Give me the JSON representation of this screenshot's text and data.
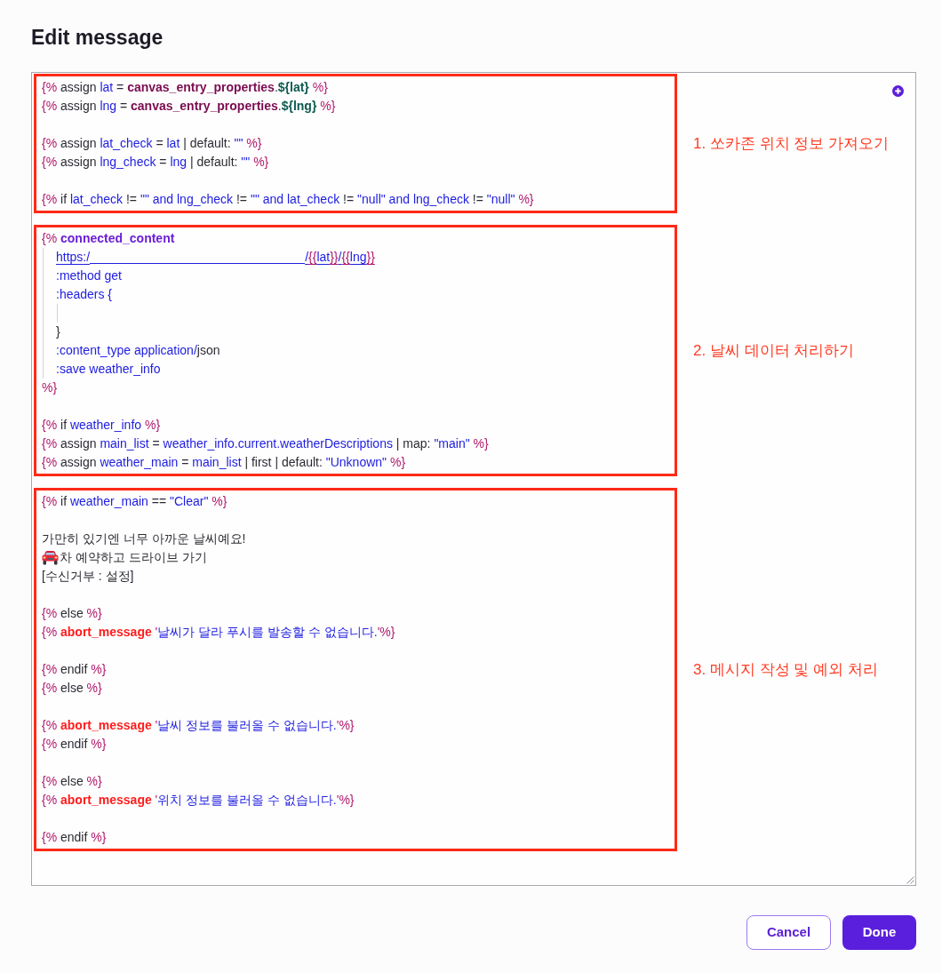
{
  "dialog": {
    "title": "Edit message"
  },
  "editor": {
    "sections": [
      {
        "label": "1. 쏘카존 위치 정보 가져오기",
        "lines": [
          {
            "kind": "code",
            "tokens": [
              {
                "kind": "delimiter",
                "text": "{%"
              },
              {
                "kind": "plain",
                "text": " assign "
              },
              {
                "kind": "name",
                "text": "lat"
              },
              {
                "kind": "plain",
                "text": " = "
              },
              {
                "kind": "property",
                "text": "canvas_entry_properties"
              },
              {
                "kind": "plain",
                "text": "."
              },
              {
                "kind": "interpolation",
                "text": "${lat}"
              },
              {
                "kind": "delimiter",
                "text": " %}"
              }
            ]
          },
          {
            "kind": "code",
            "tokens": [
              {
                "kind": "delimiter",
                "text": "{%"
              },
              {
                "kind": "plain",
                "text": " assign "
              },
              {
                "kind": "name",
                "text": "lng"
              },
              {
                "kind": "plain",
                "text": " = "
              },
              {
                "kind": "property",
                "text": "canvas_entry_properties"
              },
              {
                "kind": "plain",
                "text": "."
              },
              {
                "kind": "interpolation",
                "text": "${lng}"
              },
              {
                "kind": "delimiter",
                "text": " %}"
              }
            ]
          },
          {
            "kind": "blank"
          },
          {
            "kind": "code",
            "tokens": [
              {
                "kind": "delimiter",
                "text": "{%"
              },
              {
                "kind": "plain",
                "text": " assign "
              },
              {
                "kind": "name",
                "text": "lat_check"
              },
              {
                "kind": "plain",
                "text": " = "
              },
              {
                "kind": "name",
                "text": "lat"
              },
              {
                "kind": "plain",
                "text": " | default: "
              },
              {
                "kind": "string",
                "text": "\"\""
              },
              {
                "kind": "delimiter",
                "text": " %}"
              }
            ]
          },
          {
            "kind": "code",
            "tokens": [
              {
                "kind": "delimiter",
                "text": "{%"
              },
              {
                "kind": "plain",
                "text": " assign "
              },
              {
                "kind": "name",
                "text": "lng_check"
              },
              {
                "kind": "plain",
                "text": " = "
              },
              {
                "kind": "name",
                "text": "lng"
              },
              {
                "kind": "plain",
                "text": " | default: "
              },
              {
                "kind": "string",
                "text": "\"\""
              },
              {
                "kind": "delimiter",
                "text": " %}"
              }
            ]
          },
          {
            "kind": "blank"
          },
          {
            "kind": "code",
            "tokens": [
              {
                "kind": "delimiter",
                "text": "{%"
              },
              {
                "kind": "plain",
                "text": " if "
              },
              {
                "kind": "name",
                "text": "lat_check"
              },
              {
                "kind": "plain",
                "text": " != "
              },
              {
                "kind": "string",
                "text": "\"\" and "
              },
              {
                "kind": "name",
                "text": "lng_check"
              },
              {
                "kind": "plain",
                "text": " != "
              },
              {
                "kind": "string",
                "text": "\"\" and "
              },
              {
                "kind": "name",
                "text": "lat_check"
              },
              {
                "kind": "plain",
                "text": " != "
              },
              {
                "kind": "string",
                "text": "\"null\" and "
              },
              {
                "kind": "name",
                "text": "lng_check"
              },
              {
                "kind": "plain",
                "text": " != "
              },
              {
                "kind": "string",
                "text": "\"null\""
              },
              {
                "kind": "delimiter",
                "text": " %}"
              }
            ]
          }
        ]
      },
      {
        "label": "2. 날씨 데이터 처리하기",
        "lines": [
          {
            "kind": "code",
            "tokens": [
              {
                "kind": "delimiter",
                "text": "{% "
              },
              {
                "kind": "tag",
                "text": "connected_content"
              }
            ],
            "children": [
              {
                "kind": "url",
                "tokens": [
                  {
                    "kind": "name",
                    "text": "https:/"
                  },
                  {
                    "kind": "redacted"
                  },
                  {
                    "kind": "name",
                    "text": "/"
                  },
                  {
                    "kind": "delimiter",
                    "text": "{{"
                  },
                  {
                    "kind": "name",
                    "text": "lat"
                  },
                  {
                    "kind": "delimiter",
                    "text": "}}"
                  },
                  {
                    "kind": "name",
                    "text": "/"
                  },
                  {
                    "kind": "delimiter",
                    "text": "{{"
                  },
                  {
                    "kind": "name",
                    "text": "lng"
                  },
                  {
                    "kind": "delimiter",
                    "text": "}}"
                  }
                ]
              },
              {
                "kind": "code",
                "tokens": [
                  {
                    "kind": "name",
                    "text": ":method get"
                  }
                ]
              },
              {
                "kind": "code",
                "tokens": [
                  {
                    "kind": "name",
                    "text": ":headers {"
                  }
                ],
                "children": [
                  {
                    "kind": "blank"
                  }
                ]
              },
              {
                "kind": "code",
                "tokens": [
                  {
                    "kind": "plain",
                    "text": "}"
                  }
                ]
              },
              {
                "kind": "code",
                "tokens": [
                  {
                    "kind": "name",
                    "text": ":content_type application/"
                  },
                  {
                    "kind": "plain",
                    "text": "json"
                  }
                ]
              },
              {
                "kind": "code",
                "tokens": [
                  {
                    "kind": "name",
                    "text": ":save weather_info"
                  }
                ]
              }
            ]
          },
          {
            "kind": "code",
            "tokens": [
              {
                "kind": "delimiter",
                "text": "%}"
              }
            ]
          },
          {
            "kind": "blank"
          },
          {
            "kind": "code",
            "tokens": [
              {
                "kind": "delimiter",
                "text": "{%"
              },
              {
                "kind": "plain",
                "text": " if "
              },
              {
                "kind": "name",
                "text": "weather_info"
              },
              {
                "kind": "delimiter",
                "text": " %}"
              }
            ]
          },
          {
            "kind": "code",
            "tokens": [
              {
                "kind": "delimiter",
                "text": "{%"
              },
              {
                "kind": "plain",
                "text": " assign "
              },
              {
                "kind": "name",
                "text": "main_list"
              },
              {
                "kind": "plain",
                "text": " = "
              },
              {
                "kind": "name",
                "text": "weather_info.current.weatherDescriptions"
              },
              {
                "kind": "plain",
                "text": " | map: "
              },
              {
                "kind": "string",
                "text": "\"main\""
              },
              {
                "kind": "delimiter",
                "text": " %}"
              }
            ]
          },
          {
            "kind": "code",
            "tokens": [
              {
                "kind": "delimiter",
                "text": "{%"
              },
              {
                "kind": "plain",
                "text": " assign "
              },
              {
                "kind": "name",
                "text": "weather_main"
              },
              {
                "kind": "plain",
                "text": " = "
              },
              {
                "kind": "name",
                "text": "main_list"
              },
              {
                "kind": "plain",
                "text": " | first | default: "
              },
              {
                "kind": "string",
                "text": "\"Unknown\""
              },
              {
                "kind": "delimiter",
                "text": " %}"
              }
            ]
          }
        ]
      },
      {
        "label": "3. 메시지 작성 및 예외 처리",
        "lines": [
          {
            "kind": "code",
            "tokens": [
              {
                "kind": "delimiter",
                "text": "{%"
              },
              {
                "kind": "plain",
                "text": " if "
              },
              {
                "kind": "name",
                "text": "weather_main"
              },
              {
                "kind": "plain",
                "text": " == "
              },
              {
                "kind": "string",
                "text": "\"Clear\""
              },
              {
                "kind": "delimiter",
                "text": " %}"
              }
            ]
          },
          {
            "kind": "blank"
          },
          {
            "kind": "text",
            "text": "가만히 있기엔 너무 아까운 날씨예요!"
          },
          {
            "kind": "icon_text",
            "text": "차 예약하고 드라이브 가기"
          },
          {
            "kind": "text",
            "text": "[수신거부 : 설정]"
          },
          {
            "kind": "blank"
          },
          {
            "kind": "code",
            "tokens": [
              {
                "kind": "delimiter",
                "text": "{%"
              },
              {
                "kind": "plain",
                "text": " else "
              },
              {
                "kind": "delimiter",
                "text": "%}"
              }
            ]
          },
          {
            "kind": "code",
            "tokens": [
              {
                "kind": "delimiter",
                "text": "{% "
              },
              {
                "kind": "abort",
                "text": "abort_message"
              },
              {
                "kind": "delimiter",
                "text": " '"
              },
              {
                "kind": "string",
                "text": "날씨가 달라 푸시를 발송할 수 없습니다."
              },
              {
                "kind": "delimiter",
                "text": "'%}"
              }
            ]
          },
          {
            "kind": "blank"
          },
          {
            "kind": "code",
            "tokens": [
              {
                "kind": "delimiter",
                "text": "{%"
              },
              {
                "kind": "plain",
                "text": " endif "
              },
              {
                "kind": "delimiter",
                "text": "%}"
              }
            ]
          },
          {
            "kind": "code",
            "tokens": [
              {
                "kind": "delimiter",
                "text": "{%"
              },
              {
                "kind": "plain",
                "text": " else "
              },
              {
                "kind": "delimiter",
                "text": "%}"
              }
            ]
          },
          {
            "kind": "blank"
          },
          {
            "kind": "code",
            "tokens": [
              {
                "kind": "delimiter",
                "text": "{% "
              },
              {
                "kind": "abort",
                "text": "abort_message"
              },
              {
                "kind": "delimiter",
                "text": " '"
              },
              {
                "kind": "string",
                "text": "날씨 정보를 불러올 수 없습니다."
              },
              {
                "kind": "delimiter",
                "text": "'%}"
              }
            ]
          },
          {
            "kind": "code",
            "tokens": [
              {
                "kind": "delimiter",
                "text": "{%"
              },
              {
                "kind": "plain",
                "text": " endif "
              },
              {
                "kind": "delimiter",
                "text": "%}"
              }
            ]
          },
          {
            "kind": "blank"
          },
          {
            "kind": "code",
            "tokens": [
              {
                "kind": "delimiter",
                "text": "{%"
              },
              {
                "kind": "plain",
                "text": " else "
              },
              {
                "kind": "delimiter",
                "text": "%}"
              }
            ]
          },
          {
            "kind": "code",
            "tokens": [
              {
                "kind": "delimiter",
                "text": "{% "
              },
              {
                "kind": "abort",
                "text": "abort_message"
              },
              {
                "kind": "delimiter",
                "text": " '"
              },
              {
                "kind": "string",
                "text": "위치 정보를 불러올 수 없습니다."
              },
              {
                "kind": "delimiter",
                "text": "'%}"
              }
            ]
          },
          {
            "kind": "blank"
          },
          {
            "kind": "code",
            "tokens": [
              {
                "kind": "delimiter",
                "text": "{%"
              },
              {
                "kind": "plain",
                "text": " endif "
              },
              {
                "kind": "delimiter",
                "text": "%}"
              }
            ]
          }
        ]
      }
    ]
  },
  "buttons": [
    {
      "label": "Cancel",
      "kind": "secondary"
    },
    {
      "label": "Done",
      "kind": "primary"
    }
  ]
}
